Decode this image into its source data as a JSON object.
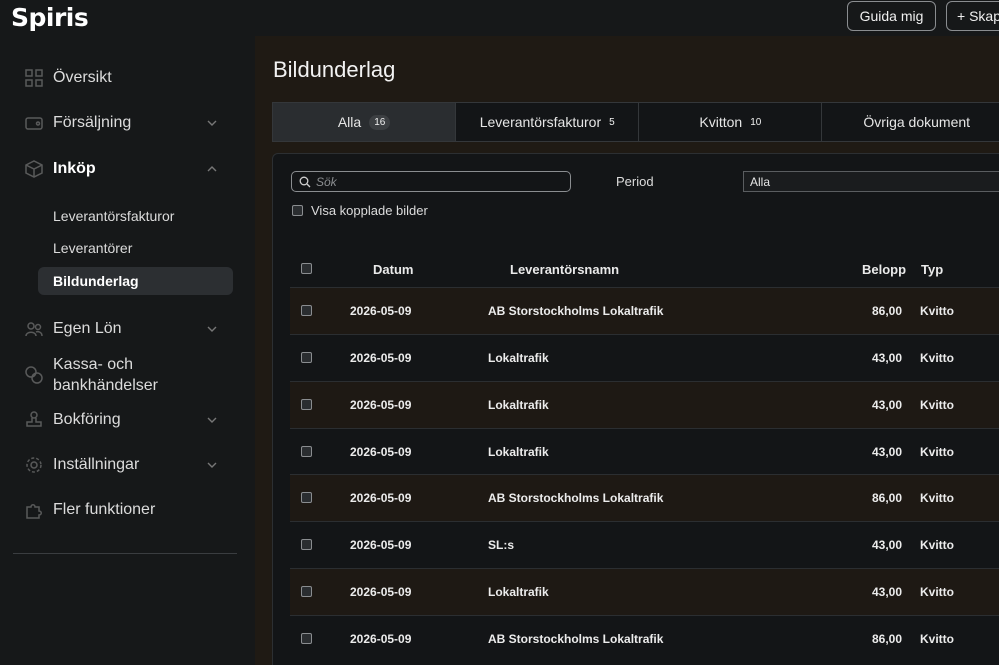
{
  "app": {
    "logo": "Spiris"
  },
  "header": {
    "guide_button": "Guida mig",
    "create_button": "+ Skapa"
  },
  "sidebar": {
    "items": [
      {
        "label": "Översikt",
        "icon": "grid-icon",
        "chevron": false
      },
      {
        "label": "Försäljning",
        "icon": "wallet-icon",
        "chevron": "down"
      },
      {
        "label": "Inköp",
        "icon": "box-icon",
        "chevron": "up",
        "expanded": true
      },
      {
        "label": "Egen Lön",
        "icon": "people-icon",
        "chevron": "down"
      },
      {
        "label": "Kassa- och bankhändelser",
        "icon": "coins-icon",
        "chevron": false
      },
      {
        "label": "Bokföring",
        "icon": "stamp-icon",
        "chevron": "down"
      },
      {
        "label": "Inställningar",
        "icon": "gear-icon",
        "chevron": "down"
      },
      {
        "label": "Fler funktioner",
        "icon": "puzzle-icon",
        "chevron": false
      }
    ],
    "sub_items": [
      "Leverantörsfakturor",
      "Leverantörer",
      "Bildunderlag"
    ],
    "active_sub": "Bildunderlag"
  },
  "page": {
    "title": "Bildunderlag"
  },
  "tabs": [
    {
      "label": "Alla",
      "count": "16",
      "active": true
    },
    {
      "label": "Leverantörsfakturor",
      "count": "5"
    },
    {
      "label": "Kvitton",
      "count": "10"
    },
    {
      "label": "Övriga dokument",
      "count": ""
    }
  ],
  "filters": {
    "search_placeholder": "Sök",
    "period_label": "Period",
    "period_value": "Alla",
    "show_linked_label": "Visa kopplade bilder",
    "show_linked_checked": false
  },
  "table": {
    "columns": [
      "Datum",
      "Leverantörsnamn",
      "Belopp",
      "Typ"
    ],
    "rows": [
      {
        "date": "2026-05-09",
        "supplier": "AB Storstockholms Lokaltrafik",
        "amount": "86,00",
        "type": "Kvitto"
      },
      {
        "date": "2026-05-09",
        "supplier": "Lokaltrafik",
        "amount": "43,00",
        "type": "Kvitto"
      },
      {
        "date": "2026-05-09",
        "supplier": "Lokaltrafik",
        "amount": "43,00",
        "type": "Kvitto"
      },
      {
        "date": "2026-05-09",
        "supplier": "Lokaltrafik",
        "amount": "43,00",
        "type": "Kvitto"
      },
      {
        "date": "2026-05-09",
        "supplier": "AB Storstockholms Lokaltrafik",
        "amount": "86,00",
        "type": "Kvitto"
      },
      {
        "date": "2026-05-09",
        "supplier": "SL:s",
        "amount": "43,00",
        "type": "Kvitto"
      },
      {
        "date": "2026-05-09",
        "supplier": "Lokaltrafik",
        "amount": "43,00",
        "type": "Kvitto"
      },
      {
        "date": "2026-05-09",
        "supplier": "AB Storstockholms Lokaltrafik",
        "amount": "86,00",
        "type": "Kvitto"
      }
    ]
  },
  "colors": {
    "background": "#161819",
    "main": "#1f1a14",
    "row_alt": "#1e1914",
    "panel": "#131517"
  }
}
